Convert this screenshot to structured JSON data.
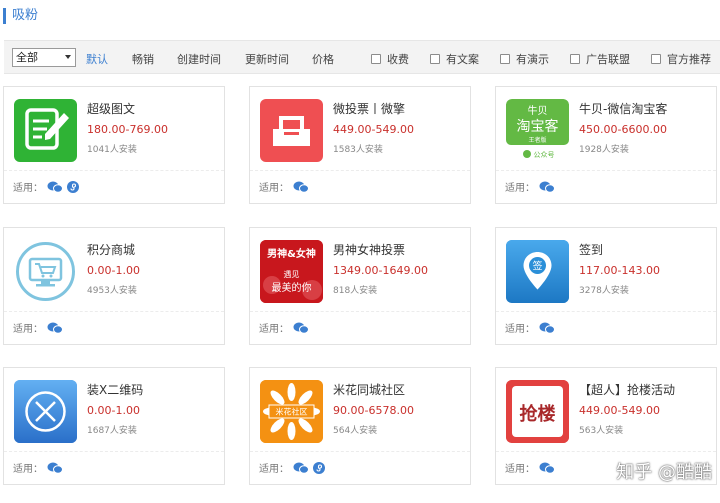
{
  "page_title": "吸粉",
  "filters": {
    "category_selected": "全部",
    "sort_options": [
      {
        "label": "默认",
        "active": true
      },
      {
        "label": "畅销",
        "active": false
      },
      {
        "label": "创建时间",
        "active": false
      },
      {
        "label": "更新时间",
        "active": false
      },
      {
        "label": "价格",
        "active": false
      }
    ],
    "checkboxes": [
      {
        "label": "收费",
        "checked": false
      },
      {
        "label": "有文案",
        "checked": false
      },
      {
        "label": "有演示",
        "checked": false
      },
      {
        "label": "广告联盟",
        "checked": false
      },
      {
        "label": "官方推荐",
        "checked": false
      }
    ]
  },
  "fit_label": "适用：",
  "apps": [
    {
      "name": "超级图文",
      "price": "180.00-769.00",
      "installs": "1041人安装",
      "icon": "edit-note-icon",
      "platforms": [
        "wechat-icon",
        "mini-program-icon"
      ]
    },
    {
      "name": "微投票丨微擎",
      "price": "449.00-549.00",
      "installs": "1583人安装",
      "icon": "ballot-box-icon",
      "platforms": [
        "wechat-icon"
      ]
    },
    {
      "name": "牛贝-微信淘宝客",
      "price": "450.00-6600.00",
      "installs": "1928人安装",
      "icon": "taobaoke-logo-icon",
      "platforms": [
        "wechat-icon"
      ],
      "logo_text": [
        "牛贝",
        "淘宝客",
        "王者版",
        "公众号"
      ]
    },
    {
      "name": "积分商城",
      "price": "0.00-1.00",
      "installs": "4953人安装",
      "icon": "shopping-cart-monitor-icon",
      "platforms": [
        "wechat-icon"
      ]
    },
    {
      "name": "男神女神投票",
      "price": "1349.00-1649.00",
      "installs": "818人安装",
      "icon": "god-goddess-poster-icon",
      "platforms": [
        "wechat-icon"
      ],
      "logo_text": [
        "男神&女神",
        "遇见",
        "最美的你"
      ]
    },
    {
      "name": "签到",
      "price": "117.00-143.00",
      "installs": "3278人安装",
      "icon": "location-pin-icon",
      "platforms": [
        "wechat-icon"
      ],
      "logo_text": [
        "签"
      ]
    },
    {
      "name": "装X二维码",
      "price": "0.00-1.00",
      "installs": "1687人安装",
      "icon": "x-circle-icon",
      "platforms": [
        "wechat-icon"
      ]
    },
    {
      "name": "米花同城社区",
      "price": "90.00-6578.00",
      "installs": "564人安装",
      "icon": "flower-logo-icon",
      "platforms": [
        "wechat-icon",
        "mini-program-icon"
      ],
      "logo_text": [
        "米花社区"
      ]
    },
    {
      "name": "【超人】抢楼活动",
      "price": "449.00-549.00",
      "installs": "563人安装",
      "icon": "calligraphy-logo-icon",
      "platforms": [
        "wechat-icon"
      ],
      "logo_text": [
        "抢楼"
      ]
    }
  ],
  "watermark": "知乎 @酷酷",
  "colors": {
    "accent": "#3c7fd0",
    "price": "#c9302c"
  }
}
